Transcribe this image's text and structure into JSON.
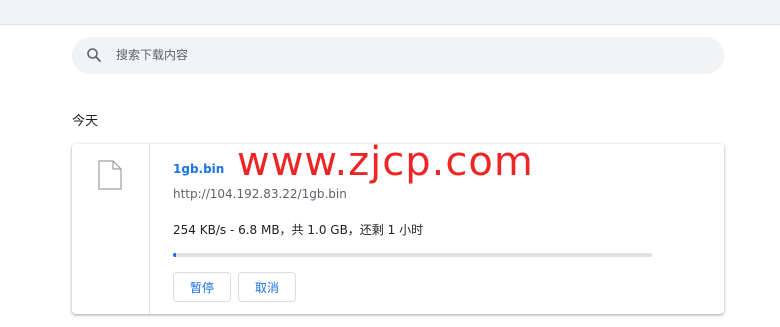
{
  "search": {
    "placeholder": "搜索下载内容",
    "icon": "search-icon"
  },
  "section": {
    "title": "今天"
  },
  "download": {
    "file_icon": "file-icon",
    "filename": "1gb.bin",
    "url": "http://104.192.83.22/1gb.bin",
    "status": "254 KB/s - 6.8 MB，共 1.0 GB，还剩 1 小时",
    "progress_fraction": 0.0068,
    "pause_label": "暂停",
    "cancel_label": "取消"
  },
  "watermark": "www.zjcp.com",
  "colors": {
    "accent": "#1a73e8",
    "watermark": "#ee2525",
    "search_bg": "#f1f3f4"
  }
}
